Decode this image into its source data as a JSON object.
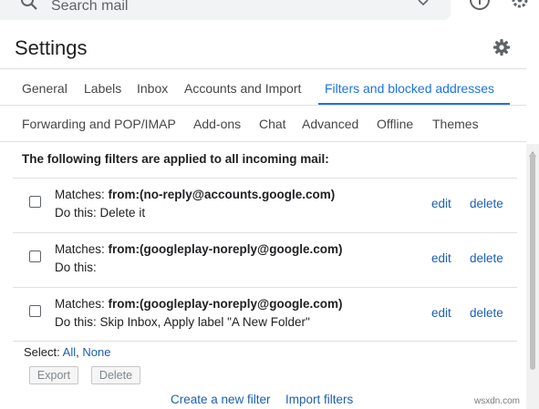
{
  "search": {
    "placeholder": "Search mail"
  },
  "header": {
    "title": "Settings"
  },
  "tabs_row1": [
    {
      "label": "General",
      "active": false
    },
    {
      "label": "Labels",
      "active": false
    },
    {
      "label": "Inbox",
      "active": false
    },
    {
      "label": "Accounts and Import",
      "active": false
    },
    {
      "label": "Filters and blocked addresses",
      "active": true
    }
  ],
  "tabs_row2": [
    {
      "label": "Forwarding and POP/IMAP"
    },
    {
      "label": "Add-ons"
    },
    {
      "label": "Chat"
    },
    {
      "label": "Advanced"
    },
    {
      "label": "Offline"
    },
    {
      "label": "Themes"
    }
  ],
  "filters": {
    "heading": "The following filters are applied to all incoming mail:",
    "matches_label": "Matches:",
    "dothis_label": "Do this:",
    "edit_label": "edit",
    "delete_label": "delete",
    "rows": [
      {
        "criteria": "from:(no-reply@accounts.google.com)",
        "action": "Delete it"
      },
      {
        "criteria": "from:(googleplay-noreply@google.com)",
        "action": ""
      },
      {
        "criteria": "from:(googleplay-noreply@google.com)",
        "action": "Skip Inbox, Apply label \"A New Folder\""
      }
    ]
  },
  "selection": {
    "label": "Select:",
    "all": "All",
    "separator": ",",
    "none": "None"
  },
  "actions": {
    "export": "Export",
    "delete": "Delete"
  },
  "bottom_links": {
    "create": "Create a new filter",
    "import": "Import filters"
  },
  "watermark": "wsxdn.com",
  "colors": {
    "accent": "#1a73e8",
    "link": "#1a5fb4",
    "text": "#202124"
  }
}
